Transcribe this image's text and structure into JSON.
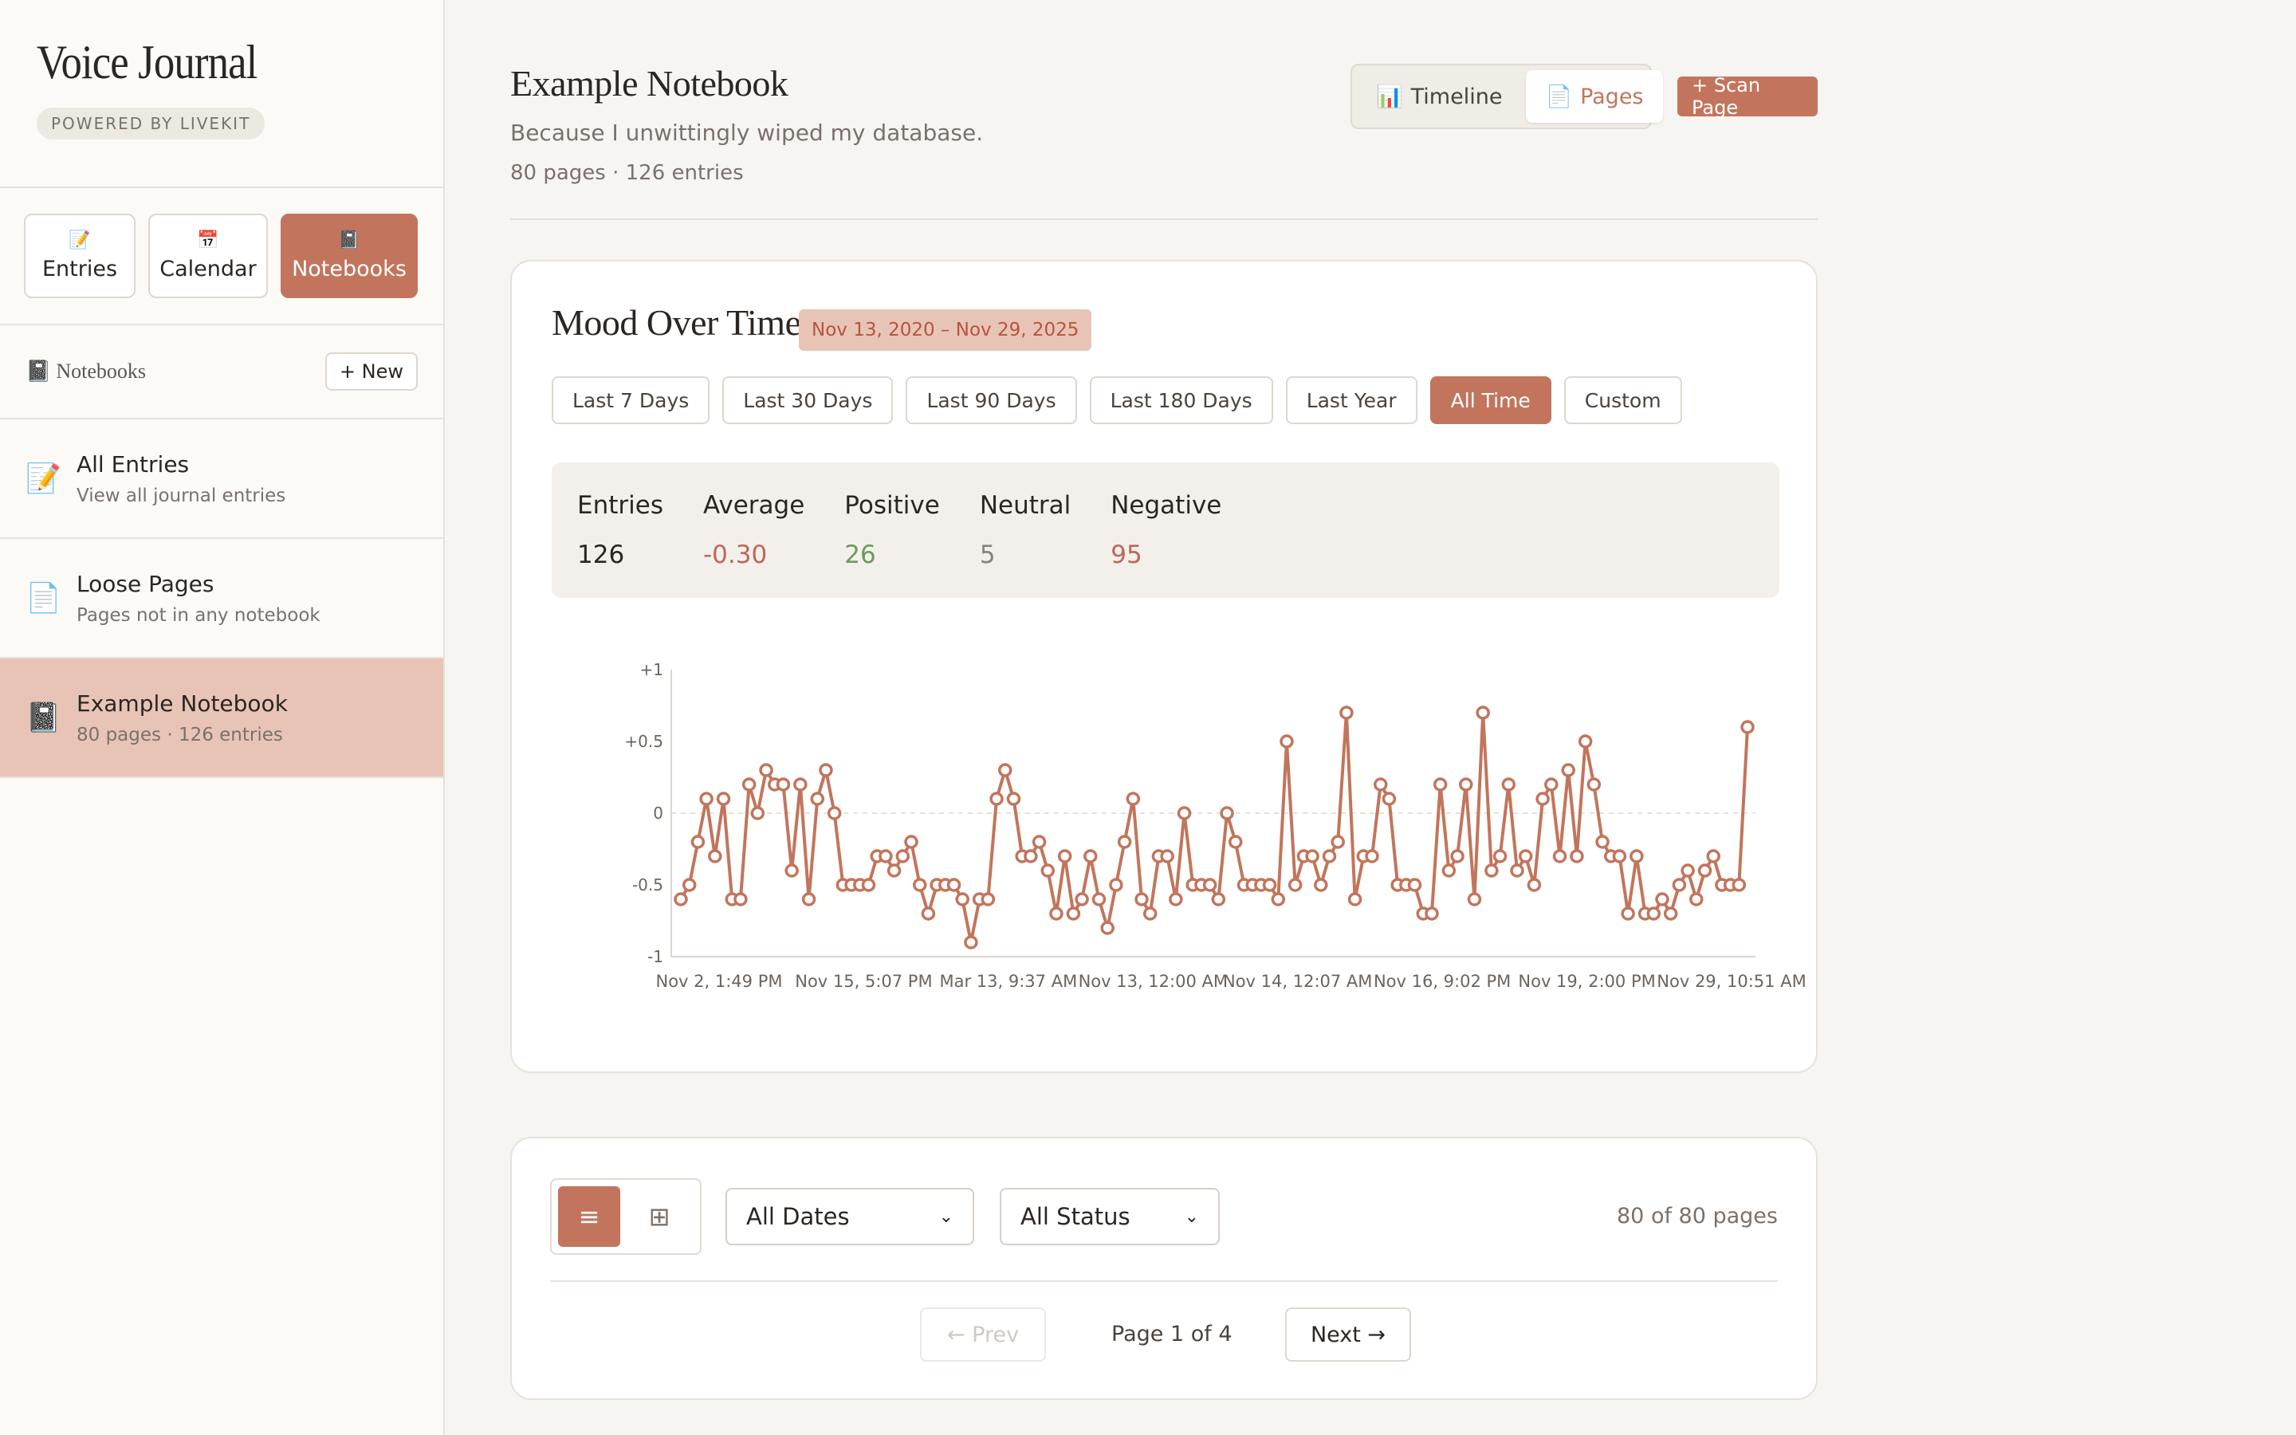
{
  "sidebar": {
    "brand_title": "Voice Journal",
    "brand_badge": "POWERED BY LIVEKIT",
    "modes": [
      {
        "label": "Entries",
        "icon": "📝"
      },
      {
        "label": "Calendar",
        "icon": "📅"
      },
      {
        "label": "Notebooks",
        "icon": "📓"
      }
    ],
    "notebooks_label": "Notebooks",
    "notebooks_icon": "📓",
    "new_label": "+ New",
    "items": [
      {
        "title": "All Entries",
        "subtitle": "View all journal entries",
        "icon": "📝"
      },
      {
        "title": "Loose Pages",
        "subtitle": "Pages not in any notebook",
        "icon": "📄"
      },
      {
        "title": "Example Notebook",
        "subtitle": "80 pages · 126 entries",
        "icon": "📓"
      }
    ]
  },
  "header": {
    "title": "Example Notebook",
    "subtitle": "Because I unwittingly wiped my database.",
    "meta": "80 pages  ·  126 entries",
    "views": [
      {
        "label": "Timeline",
        "icon": "📊"
      },
      {
        "label": "Pages",
        "icon": "📄"
      }
    ],
    "scan_label": "+ Scan Page"
  },
  "mood": {
    "title": "Mood Over Time",
    "range_badge": "Nov 13, 2020 – Nov 29, 2025",
    "ranges": [
      "Last 7 Days",
      "Last 30 Days",
      "Last 90 Days",
      "Last 180 Days",
      "Last Year",
      "All Time",
      "Custom"
    ],
    "active_range": "All Time",
    "stats": [
      {
        "label": "Entries",
        "value": "126",
        "color": "#2b2622"
      },
      {
        "label": "Average",
        "value": "-0.30",
        "color": "#c0655a"
      },
      {
        "label": "Positive",
        "value": "26",
        "color": "#6b9a5e"
      },
      {
        "label": "Neutral",
        "value": "5",
        "color": "#8a827b"
      },
      {
        "label": "Negative",
        "value": "95",
        "color": "#c0655a"
      }
    ]
  },
  "chart_data": {
    "type": "line",
    "title": "",
    "xlabel": "",
    "ylabel": "",
    "ylim": [
      -1,
      1
    ],
    "y_ticks": [
      "+1",
      "+0.5",
      "0",
      "-0.5",
      "-1"
    ],
    "x_tick_labels": [
      "Nov 2, 1:49 PM",
      "Nov 15, 5:07 PM",
      "Mar 13, 9:37 AM",
      "Nov 13, 12:00 AM",
      "Nov 14, 12:07 AM",
      "Nov 16, 9:02 PM",
      "Nov 19, 2:00 PM",
      "Nov 29, 10:51 AM"
    ],
    "color": "#c2755c",
    "series": [
      {
        "values": [
          -0.6,
          -0.5,
          -0.2,
          0.1,
          -0.3,
          0.1,
          -0.6,
          -0.6,
          0.2,
          0,
          0.3,
          0.2,
          0.2,
          -0.4,
          0.2,
          -0.6,
          0.1,
          0.3,
          0,
          -0.5,
          -0.5,
          -0.5,
          -0.5,
          -0.3,
          -0.3,
          -0.4,
          -0.3,
          -0.2,
          -0.5,
          -0.7,
          -0.5,
          -0.5,
          -0.5,
          -0.6,
          -0.9,
          -0.6,
          -0.6,
          0.1,
          0.3,
          0.1,
          -0.3,
          -0.3,
          -0.2,
          -0.4,
          -0.7,
          -0.3,
          -0.7,
          -0.6,
          -0.3,
          -0.6,
          -0.8,
          -0.5,
          -0.2,
          0.1,
          -0.6,
          -0.7,
          -0.3,
          -0.3,
          -0.6,
          0,
          -0.5,
          -0.5,
          -0.5,
          -0.6,
          0,
          -0.2,
          -0.5,
          -0.5,
          -0.5,
          -0.5,
          -0.6,
          0.5,
          -0.5,
          -0.3,
          -0.3,
          -0.5,
          -0.3,
          -0.2,
          0.7,
          -0.6,
          -0.3,
          -0.3,
          0.2,
          0.1,
          -0.5,
          -0.5,
          -0.5,
          -0.7,
          -0.7,
          0.2,
          -0.4,
          -0.3,
          0.2,
          -0.6,
          0.7,
          -0.4,
          -0.3,
          0.2,
          -0.4,
          -0.3,
          -0.5,
          0.1,
          0.2,
          -0.3,
          0.3,
          -0.3,
          0.5,
          0.2,
          -0.2,
          -0.3,
          -0.3,
          -0.7,
          -0.3,
          -0.7,
          -0.7,
          -0.6,
          -0.7,
          -0.5,
          -0.4,
          -0.6,
          -0.4,
          -0.3,
          -0.5,
          -0.5,
          -0.5,
          0.6
        ]
      }
    ]
  },
  "pages": {
    "date_filter": "All Dates",
    "status_filter": "All Status",
    "count_text": "80 of 80 pages",
    "prev_label": "← Prev",
    "page_label": "Page 1 of 4",
    "next_label": "Next →"
  }
}
